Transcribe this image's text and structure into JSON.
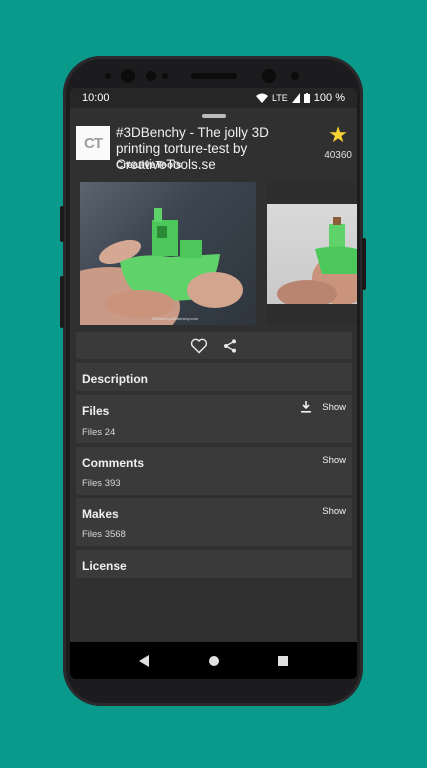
{
  "status_bar": {
    "time": "10:00",
    "network": "LTE",
    "battery": "100 %"
  },
  "thing": {
    "title": "#3DBenchy - The jolly 3D printing torture-test by CreativeTools.se",
    "author": "CreativeTools",
    "logo_text": "CT",
    "like_count": "40360",
    "star_icon": "star-icon",
    "image_caption": "3DBenchy.3DBenchy.com"
  },
  "actions": {
    "like_icon": "heart-outline-icon",
    "share_icon": "share-icon"
  },
  "sections": {
    "description": {
      "title": "Description"
    },
    "files": {
      "title": "Files",
      "count": "Files 24",
      "show": "Show"
    },
    "comments": {
      "title": "Comments",
      "count": "Files 393",
      "show": "Show"
    },
    "makes": {
      "title": "Makes",
      "count": "Files 3568",
      "show": "Show"
    },
    "license": {
      "title": "License"
    }
  },
  "nav": {
    "back_icon": "back-icon",
    "home_icon": "home-icon",
    "recents_icon": "recents-icon"
  },
  "colors": {
    "background": "#0a9a8c",
    "sheet": "#303030",
    "card": "#3a3a3a",
    "star": "#f7d232"
  }
}
